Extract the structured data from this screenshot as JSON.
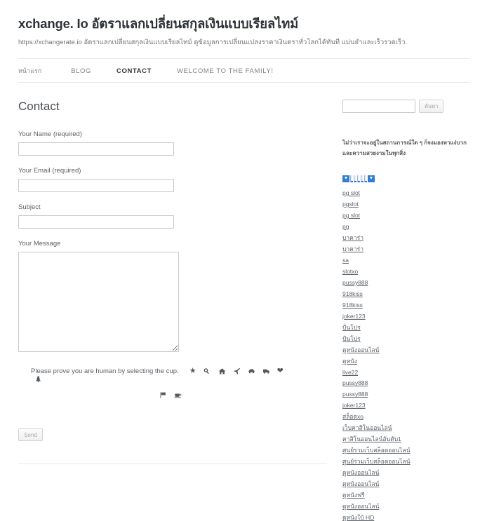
{
  "header": {
    "site_title": "xchange. Io อัตราแลกเปลี่ยนสกุลเงินแบบเรียลไทม์",
    "site_description": "https://xchangerate.io อัตราแลกเปลี่ยนสกุลเงินแบบเรียลไทม์ ดูข้อมูลการเปลี่ยนแปลงราคาเงินตราทั่วโลกได้ทันที แม่นยำและเร็วรวดเร็ว.",
    "nav": [
      {
        "label": "หน้าแรก",
        "active": false,
        "thai": true
      },
      {
        "label": "BLOG",
        "active": false,
        "thai": false
      },
      {
        "label": "CONTACT",
        "active": true,
        "thai": false
      },
      {
        "label": "WELCOME TO THE FAMILY!",
        "active": false,
        "thai": false
      }
    ]
  },
  "main": {
    "page_title": "Contact",
    "fields": [
      {
        "label": "Your Name (required)",
        "value": "",
        "placeholder": "",
        "type": "text"
      },
      {
        "label": "Your Email (required)",
        "value": "",
        "placeholder": "",
        "type": "text"
      },
      {
        "label": "Subject",
        "value": "",
        "placeholder": "",
        "type": "text"
      },
      {
        "label": "Your Message",
        "value": "",
        "placeholder": "",
        "type": "textarea"
      }
    ],
    "captcha": {
      "prompt": "Please prove you are human by selecting the cup.",
      "icons_row1": [
        "star-icon",
        "key-icon",
        "home-icon",
        "plane-icon",
        "car-icon",
        "truck-icon",
        "heart-icon",
        "tree-icon"
      ],
      "icons_row2": [
        "flag-icon",
        "cup-icon"
      ]
    },
    "send_label": "Send"
  },
  "sidebar": {
    "search": {
      "value": "",
      "placeholder": "",
      "button_label": "ค้นหา"
    },
    "description": "ไม่ว่าเราจะอยู่ในสถานการณ์ใด ๆ ก็จงมองหาแง่บวกและความสวยงามในทุกสิ่ง",
    "badges": [
      "download-badge-left",
      "bar-icon",
      "bar-icon",
      "bar-icon",
      "bar-icon",
      "bar-icon",
      "download-badge-right"
    ],
    "links": [
      "pg slot",
      "pgslot",
      "pg slot",
      "pg",
      "บาคาร่า",
      "บาคาร่า",
      "sa",
      "slotxo",
      "pussy888",
      "918kiss",
      "918kiss",
      "joker123",
      "ปั่นโปร",
      "ปั่นโปร",
      "ดูหนังออนไลน์",
      "ดูหนัง",
      "live22",
      "pussy888",
      "pussy888",
      "joker123",
      "สล็อตxo",
      "เว็บคาสิโนออนไลน์",
      "คาสิโนออนไลน์อันดับ1",
      "ศูนย์รวมเว็บสล็อตออนไลน์",
      "ศูนย์รวมเว็บสล็อตออนไลน์",
      "ดูหนังออนไลน์",
      "ดูหนังออนไลน์",
      "ดูหนังฟรี",
      "ดูหนังออนไลน์",
      "ดูหนังใบ้ HD"
    ]
  }
}
